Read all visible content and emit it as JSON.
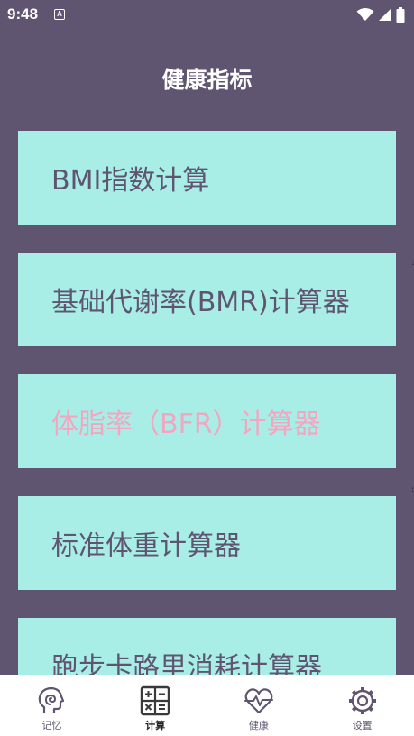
{
  "status_bar": {
    "time": "9:48",
    "notification_icon": "a-box-icon",
    "icons": [
      "wifi-icon",
      "signal-icon",
      "battery-icon"
    ]
  },
  "header": {
    "title": "健康指标"
  },
  "calculators": [
    {
      "label": "BMI指数计算",
      "active": false
    },
    {
      "label": "基础代谢率(BMR)计算器",
      "active": false
    },
    {
      "label": "体脂率（BFR）计算器",
      "active": true
    },
    {
      "label": "标准体重计算器",
      "active": false
    },
    {
      "label": "跑步卡路里消耗计算器",
      "active": false
    }
  ],
  "bottom_nav": [
    {
      "label": "记忆",
      "icon": "head-brain-icon",
      "active": false
    },
    {
      "label": "计算",
      "icon": "calculator-icon",
      "active": true
    },
    {
      "label": "健康",
      "icon": "heartbeat-icon",
      "active": false
    },
    {
      "label": "设置",
      "icon": "gear-icon",
      "active": false
    }
  ],
  "colors": {
    "background": "#605570",
    "card": "#a8ede6",
    "card_text": "#5f5570",
    "active_text": "#f3a6c0",
    "nav_background": "#ffffff"
  }
}
